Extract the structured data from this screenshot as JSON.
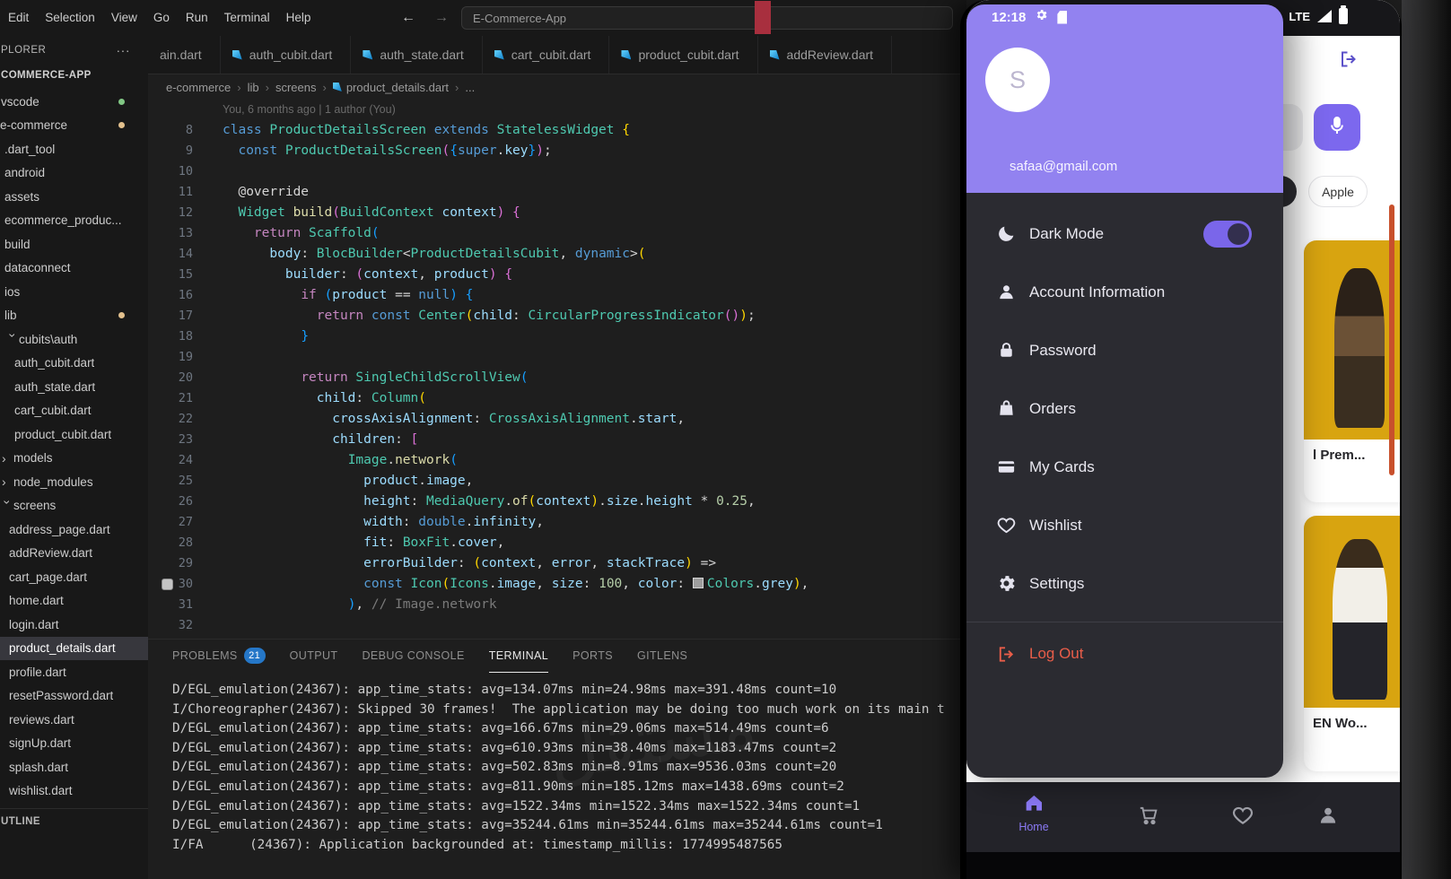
{
  "colors": {
    "accent_purple": "#9282f0",
    "toggle_purple": "#7a66ea",
    "logout_red": "#e85d49",
    "product_yellow": "#d8a410",
    "badge_blue": "#2577c8",
    "dart_blue": "#29b6f6",
    "git_modified": "#e2c08d",
    "git_added": "#81c784"
  },
  "watermark": "مستقل",
  "vscode": {
    "menu": [
      "Edit",
      "Selection",
      "View",
      "Go",
      "Run",
      "Terminal",
      "Help"
    ],
    "nav_back": "←",
    "nav_forward": "→",
    "search_placeholder": "E-Commerce-App",
    "tabs": [
      {
        "label": "ain.dart",
        "noIcon": true
      },
      {
        "label": "auth_cubit.dart"
      },
      {
        "label": "auth_state.dart"
      },
      {
        "label": "cart_cubit.dart"
      },
      {
        "label": "product_cubit.dart"
      },
      {
        "label": "addReview.dart"
      }
    ],
    "breadcrumb": [
      "e-commerce",
      "lib",
      "screens",
      "product_details.dart",
      "..."
    ],
    "explorer": {
      "header": "PLORER",
      "actions": "···",
      "project": "COMMERCE-APP",
      "outline_header": "UTLINE",
      "items": [
        {
          "label": "vscode",
          "indent": 1,
          "dot": "#81c784"
        },
        {
          "label": "e-commerce",
          "indent": 0,
          "dot": "#e2c08d"
        },
        {
          "label": ".dart_tool",
          "indent": 5
        },
        {
          "label": "android",
          "indent": 5
        },
        {
          "label": "assets",
          "indent": 5
        },
        {
          "label": "ecommerce_produc...",
          "indent": 5
        },
        {
          "label": "build",
          "indent": 5
        },
        {
          "label": "dataconnect",
          "indent": 5
        },
        {
          "label": "ios",
          "indent": 5
        },
        {
          "label": "lib",
          "indent": 5,
          "dot": "#e2c08d"
        },
        {
          "label": "cubits\\auth",
          "indent": 8,
          "chevron": "down"
        },
        {
          "label": "auth_cubit.dart",
          "indent": 16
        },
        {
          "label": "auth_state.dart",
          "indent": 16
        },
        {
          "label": "cart_cubit.dart",
          "indent": 16
        },
        {
          "label": "product_cubit.dart",
          "indent": 16
        },
        {
          "label": "models",
          "indent": 2,
          "chevron": "right"
        },
        {
          "label": "node_modules",
          "indent": 2,
          "chevron": "right"
        },
        {
          "label": "screens",
          "indent": 2,
          "chevron": "down"
        },
        {
          "label": "address_page.dart",
          "indent": 10
        },
        {
          "label": "addReview.dart",
          "indent": 10
        },
        {
          "label": "cart_page.dart",
          "indent": 10
        },
        {
          "label": "home.dart",
          "indent": 10
        },
        {
          "label": "login.dart",
          "indent": 10
        },
        {
          "label": "product_details.dart",
          "indent": 10,
          "selected": true
        },
        {
          "label": "profile.dart",
          "indent": 10
        },
        {
          "label": "resetPassword.dart",
          "indent": 10
        },
        {
          "label": "reviews.dart",
          "indent": 10
        },
        {
          "label": "signUp.dart",
          "indent": 10
        },
        {
          "label": "splash.dart",
          "indent": 10
        },
        {
          "label": "wishlist.dart",
          "indent": 10
        }
      ]
    },
    "editor": {
      "codelens": "You, 6 months ago | 1 author (You)",
      "lines": [
        {
          "n": 8,
          "t": [
            [
              "kw",
              "class "
            ],
            [
              "cls",
              "ProductDetailsScreen "
            ],
            [
              "kw",
              "extends "
            ],
            [
              "cls",
              "StatelessWidget "
            ],
            [
              "b1",
              "{"
            ]
          ]
        },
        {
          "n": 9,
          "t": [
            [
              "pln",
              "  "
            ],
            [
              "kw",
              "const "
            ],
            [
              "cls",
              "ProductDetailsScreen"
            ],
            [
              "b2",
              "("
            ],
            [
              "b3",
              "{"
            ],
            [
              "kw",
              "super"
            ],
            [
              "pln",
              "."
            ],
            [
              "var",
              "key"
            ],
            [
              "b3",
              "}"
            ],
            [
              "b2",
              ")"
            ],
            [
              "pln",
              ";"
            ]
          ]
        },
        {
          "n": 10,
          "t": []
        },
        {
          "n": 11,
          "t": [
            [
              "pln",
              "  @override"
            ]
          ]
        },
        {
          "n": 12,
          "t": [
            [
              "pln",
              "  "
            ],
            [
              "cls",
              "Widget "
            ],
            [
              "fn",
              "build"
            ],
            [
              "b2",
              "("
            ],
            [
              "cls",
              "BuildContext "
            ],
            [
              "var",
              "context"
            ],
            [
              "b2",
              ")"
            ],
            [
              "pln",
              " "
            ],
            [
              "b2",
              "{"
            ]
          ]
        },
        {
          "n": 13,
          "t": [
            [
              "pln",
              "    "
            ],
            [
              "ctrl",
              "return "
            ],
            [
              "cls",
              "Scaffold"
            ],
            [
              "b3",
              "("
            ]
          ]
        },
        {
          "n": 14,
          "t": [
            [
              "pln",
              "      "
            ],
            [
              "var",
              "body"
            ],
            [
              "pln",
              ": "
            ],
            [
              "cls",
              "BlocBuilder"
            ],
            [
              "pln",
              "<"
            ],
            [
              "cls",
              "ProductDetailsCubit"
            ],
            [
              "pln",
              ", "
            ],
            [
              "kw",
              "dynamic"
            ],
            [
              "pln",
              ">"
            ],
            [
              "b1",
              "("
            ]
          ]
        },
        {
          "n": 15,
          "t": [
            [
              "pln",
              "        "
            ],
            [
              "var",
              "builder"
            ],
            [
              "pln",
              ": "
            ],
            [
              "b2",
              "("
            ],
            [
              "var",
              "context"
            ],
            [
              "pln",
              ", "
            ],
            [
              "var",
              "product"
            ],
            [
              "b2",
              ")"
            ],
            [
              "pln",
              " "
            ],
            [
              "b2",
              "{"
            ]
          ]
        },
        {
          "n": 16,
          "t": [
            [
              "pln",
              "          "
            ],
            [
              "ctrl",
              "if "
            ],
            [
              "b3",
              "("
            ],
            [
              "var",
              "product"
            ],
            [
              "pln",
              " == "
            ],
            [
              "kw",
              "null"
            ],
            [
              "b3",
              ")"
            ],
            [
              "pln",
              " "
            ],
            [
              "b3",
              "{"
            ]
          ]
        },
        {
          "n": 17,
          "t": [
            [
              "pln",
              "            "
            ],
            [
              "ctrl",
              "return "
            ],
            [
              "kw",
              "const "
            ],
            [
              "cls",
              "Center"
            ],
            [
              "b1",
              "("
            ],
            [
              "var",
              "child"
            ],
            [
              "pln",
              ": "
            ],
            [
              "cls",
              "CircularProgressIndicator"
            ],
            [
              "b2",
              "("
            ],
            [
              "b2",
              ")"
            ],
            [
              "b1",
              ")"
            ],
            [
              "pln",
              ";"
            ]
          ]
        },
        {
          "n": 18,
          "t": [
            [
              "pln",
              "          "
            ],
            [
              "b3",
              "}"
            ]
          ]
        },
        {
          "n": 19,
          "t": []
        },
        {
          "n": 20,
          "t": [
            [
              "pln",
              "          "
            ],
            [
              "ctrl",
              "return "
            ],
            [
              "cls",
              "SingleChildScrollView"
            ],
            [
              "b3",
              "("
            ]
          ]
        },
        {
          "n": 21,
          "t": [
            [
              "pln",
              "            "
            ],
            [
              "var",
              "child"
            ],
            [
              "pln",
              ": "
            ],
            [
              "cls",
              "Column"
            ],
            [
              "b1",
              "("
            ]
          ]
        },
        {
          "n": 22,
          "t": [
            [
              "pln",
              "              "
            ],
            [
              "var",
              "crossAxisAlignment"
            ],
            [
              "pln",
              ": "
            ],
            [
              "cls",
              "CrossAxisAlignment"
            ],
            [
              "pln",
              "."
            ],
            [
              "var",
              "start"
            ],
            [
              "pln",
              ","
            ]
          ]
        },
        {
          "n": 23,
          "t": [
            [
              "pln",
              "              "
            ],
            [
              "var",
              "children"
            ],
            [
              "pln",
              ": "
            ],
            [
              "b2",
              "["
            ]
          ]
        },
        {
          "n": 24,
          "t": [
            [
              "pln",
              "                "
            ],
            [
              "cls",
              "Image"
            ],
            [
              "pln",
              "."
            ],
            [
              "fn",
              "network"
            ],
            [
              "b3",
              "("
            ]
          ]
        },
        {
          "n": 25,
          "t": [
            [
              "pln",
              "                  "
            ],
            [
              "var",
              "product"
            ],
            [
              "pln",
              "."
            ],
            [
              "var",
              "image"
            ],
            [
              "pln",
              ","
            ]
          ]
        },
        {
          "n": 26,
          "t": [
            [
              "pln",
              "                  "
            ],
            [
              "var",
              "height"
            ],
            [
              "pln",
              ": "
            ],
            [
              "cls",
              "MediaQuery"
            ],
            [
              "pln",
              "."
            ],
            [
              "fn",
              "of"
            ],
            [
              "b1",
              "("
            ],
            [
              "var",
              "context"
            ],
            [
              "b1",
              ")"
            ],
            [
              "pln",
              "."
            ],
            [
              "var",
              "size"
            ],
            [
              "pln",
              "."
            ],
            [
              "var",
              "height"
            ],
            [
              "pln",
              " * "
            ],
            [
              "num",
              "0.25"
            ],
            [
              "pln",
              ","
            ]
          ]
        },
        {
          "n": 27,
          "t": [
            [
              "pln",
              "                  "
            ],
            [
              "var",
              "width"
            ],
            [
              "pln",
              ": "
            ],
            [
              "kw",
              "double"
            ],
            [
              "pln",
              "."
            ],
            [
              "var",
              "infinity"
            ],
            [
              "pln",
              ","
            ]
          ]
        },
        {
          "n": 28,
          "t": [
            [
              "pln",
              "                  "
            ],
            [
              "var",
              "fit"
            ],
            [
              "pln",
              ": "
            ],
            [
              "cls",
              "BoxFit"
            ],
            [
              "pln",
              "."
            ],
            [
              "var",
              "cover"
            ],
            [
              "pln",
              ","
            ]
          ]
        },
        {
          "n": 29,
          "t": [
            [
              "pln",
              "                  "
            ],
            [
              "var",
              "errorBuilder"
            ],
            [
              "pln",
              ": "
            ],
            [
              "b1",
              "("
            ],
            [
              "var",
              "context"
            ],
            [
              "pln",
              ", "
            ],
            [
              "var",
              "error"
            ],
            [
              "pln",
              ", "
            ],
            [
              "var",
              "stackTrace"
            ],
            [
              "b1",
              ")"
            ],
            [
              "pln",
              " =>"
            ]
          ]
        },
        {
          "n": 30,
          "icon": true,
          "t": [
            [
              "pln",
              "                  "
            ],
            [
              "kw",
              "const "
            ],
            [
              "cls",
              "Icon"
            ],
            [
              "b1",
              "("
            ],
            [
              "cls",
              "Icons"
            ],
            [
              "pln",
              "."
            ],
            [
              "var",
              "image"
            ],
            [
              "pln",
              ", "
            ],
            [
              "var",
              "size"
            ],
            [
              "pln",
              ": "
            ],
            [
              "num",
              "100"
            ],
            [
              "pln",
              ", "
            ],
            [
              "var",
              "color"
            ],
            [
              "pln",
              ": "
            ],
            [
              "swatch",
              ""
            ],
            [
              "cls",
              "Colors"
            ],
            [
              "pln",
              "."
            ],
            [
              "var",
              "grey"
            ],
            [
              "b1",
              ")"
            ],
            [
              "pln",
              ","
            ]
          ]
        },
        {
          "n": 31,
          "t": [
            [
              "pln",
              "                "
            ],
            [
              "b3",
              ")"
            ],
            [
              "pln",
              ", "
            ],
            [
              "cmt",
              "// Image.network"
            ]
          ]
        },
        {
          "n": 32,
          "t": []
        }
      ]
    },
    "panel": {
      "tabs": [
        {
          "label": "PROBLEMS",
          "badge": "21"
        },
        {
          "label": "OUTPUT"
        },
        {
          "label": "DEBUG CONSOLE"
        },
        {
          "label": "TERMINAL",
          "active": true
        },
        {
          "label": "PORTS"
        },
        {
          "label": "GITLENS"
        }
      ],
      "terminal_lines": [
        "D/EGL_emulation(24367): app_time_stats: avg=134.07ms min=24.98ms max=391.48ms count=10",
        "I/Choreographer(24367): Skipped 30 frames!  The application may be doing too much work on its main t",
        "D/EGL_emulation(24367): app_time_stats: avg=166.67ms min=29.06ms max=514.49ms count=6",
        "D/EGL_emulation(24367): app_time_stats: avg=610.93ms min=38.40ms max=1183.47ms count=2",
        "D/EGL_emulation(24367): app_time_stats: avg=502.83ms min=8.91ms max=9536.03ms count=20",
        "D/EGL_emulation(24367): app_time_stats: avg=811.90ms min=185.12ms max=1438.69ms count=2",
        "D/EGL_emulation(24367): app_time_stats: avg=1522.34ms min=1522.34ms max=1522.34ms count=1",
        "D/EGL_emulation(24367): app_time_stats: avg=35244.61ms min=35244.61ms max=35244.61ms count=1",
        "I/FA      (24367): Application backgrounded at: timestamp_millis: 1774995487565"
      ]
    }
  },
  "phone": {
    "status": {
      "time": "12:18",
      "network": "LTE"
    },
    "drawer": {
      "avatar_letter": "S",
      "email": "safaa@gmail.com",
      "items": [
        {
          "label": "Dark Mode",
          "icon": "moon",
          "toggle": true
        },
        {
          "label": "Account Information",
          "icon": "person"
        },
        {
          "label": "Password",
          "icon": "lock"
        },
        {
          "label": "Orders",
          "icon": "bag"
        },
        {
          "label": "My Cards",
          "icon": "card"
        },
        {
          "label": "Wishlist",
          "icon": "heart"
        },
        {
          "label": "Settings",
          "icon": "gear"
        }
      ],
      "logout": "Log Out"
    },
    "app": {
      "chip": "Apple",
      "card1_title": "l Prem...",
      "card2_title": "EN Wo..."
    },
    "nav": {
      "home_label": "Home"
    }
  }
}
